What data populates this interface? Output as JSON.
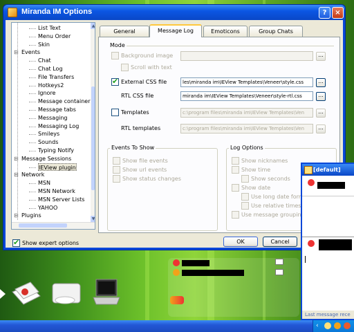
{
  "window": {
    "title": "Miranda IM Options",
    "help_glyph": "?",
    "close_glyph": "×"
  },
  "tree": {
    "items": [
      {
        "label": "List Text",
        "level": 2
      },
      {
        "label": "Menu Order",
        "level": 2
      },
      {
        "label": "Skin",
        "level": 2
      },
      {
        "label": "Events",
        "level": 1
      },
      {
        "label": "Chat",
        "level": 2
      },
      {
        "label": "Chat Log",
        "level": 2
      },
      {
        "label": "File Transfers",
        "level": 2
      },
      {
        "label": "Hotkeys2",
        "level": 2
      },
      {
        "label": "Ignore",
        "level": 2
      },
      {
        "label": "Message containers",
        "level": 2
      },
      {
        "label": "Message tabs",
        "level": 2
      },
      {
        "label": "Messaging",
        "level": 2
      },
      {
        "label": "Messaging Log",
        "level": 2
      },
      {
        "label": "Smileys",
        "level": 2
      },
      {
        "label": "Sounds",
        "level": 2
      },
      {
        "label": "Typing Notify",
        "level": 2
      },
      {
        "label": "Message Sessions",
        "level": 1
      },
      {
        "label": "IEView plugin",
        "level": 2,
        "selected": true
      },
      {
        "label": "Network",
        "level": 1
      },
      {
        "label": "MSN",
        "level": 2
      },
      {
        "label": "MSN Network",
        "level": 2
      },
      {
        "label": "MSN Server Lists",
        "level": 2
      },
      {
        "label": "YAHOO",
        "level": 2
      },
      {
        "label": "Plugins",
        "level": 1
      }
    ]
  },
  "show_expert": {
    "label": "Show expert options",
    "checked": true
  },
  "tabs": [
    {
      "label": "General",
      "active": false
    },
    {
      "label": "Message Log",
      "active": true
    },
    {
      "label": "Emoticons",
      "active": false
    },
    {
      "label": "Group Chats",
      "active": false
    }
  ],
  "mode": {
    "title": "Mode",
    "background_image": {
      "label": "Background image",
      "checked": false,
      "enabled": false,
      "value": ""
    },
    "scroll_with_text": {
      "label": "Scroll with text",
      "checked": false,
      "enabled": false
    },
    "external_css": {
      "label": "External CSS file",
      "checked": true,
      "enabled": true,
      "value": "les\\miranda im\\IEView Templates\\Veneer\\style.css"
    },
    "rtl_css": {
      "label": "RTL CSS file",
      "value": "miranda im\\IEView Templates\\Veneer\\style-rtl.css"
    },
    "templates": {
      "label": "Templates",
      "checked": false,
      "enabled": true,
      "value": "c:\\program files\\miranda im\\IEView Templates\\Ven"
    },
    "rtl_templates": {
      "label": "RTL templates",
      "value": "c:\\program files\\miranda im\\IEView Templates\\Ven"
    },
    "browse_glyph": "..."
  },
  "events_to_show": {
    "title": "Events To Show",
    "items": [
      "Show file events",
      "Show url events",
      "Show status changes"
    ]
  },
  "log_options": {
    "title": "Log Options",
    "show_nicknames": "Show nicknames",
    "show_time": "Show time",
    "show_seconds": "Show seconds",
    "show_date": "Show date",
    "use_long_date": "Use long date forma",
    "use_relative_timestamp": "Use relative timestam",
    "use_message_grouping": "Use message grouping"
  },
  "buttons": {
    "ok": "OK",
    "cancel": "Cancel"
  },
  "chat_window": {
    "title": "[default] ",
    "status": "Last message rece"
  },
  "colors": {
    "titlebar": "#0a48d8",
    "dialog_bg": "#ece9d8",
    "desktop": "#6cc02a",
    "checkmark": "#21a121"
  }
}
